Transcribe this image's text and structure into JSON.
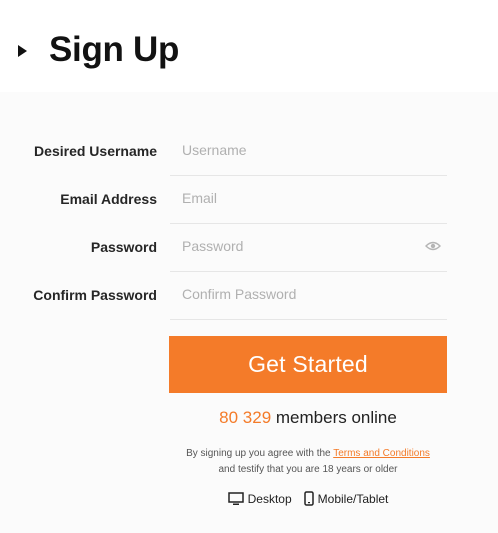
{
  "header": {
    "title": "Sign Up"
  },
  "form": {
    "username": {
      "label": "Desired Username",
      "placeholder": "Username",
      "value": ""
    },
    "email": {
      "label": "Email Address",
      "placeholder": "Email",
      "value": ""
    },
    "password": {
      "label": "Password",
      "placeholder": "Password",
      "value": ""
    },
    "confirm": {
      "label": "Confirm Password",
      "placeholder": "Confirm Password",
      "value": ""
    }
  },
  "cta": {
    "label": "Get Started"
  },
  "online": {
    "count": "80 329",
    "suffix": " members online"
  },
  "terms": {
    "prefix": "By signing up you agree with the ",
    "link": "Terms and Conditions",
    "suffix": "and testify that you are 18 years or older"
  },
  "devices": {
    "desktop": "Desktop",
    "mobile": "Mobile/Tablet"
  },
  "colors": {
    "accent": "#f47b29",
    "text": "#1f1f1f",
    "placeholder": "#b0b0b0"
  },
  "icons": {
    "header": "play-triangle-icon",
    "password": "eye-icon",
    "desktop": "monitor-icon",
    "mobile": "phone-icon"
  }
}
